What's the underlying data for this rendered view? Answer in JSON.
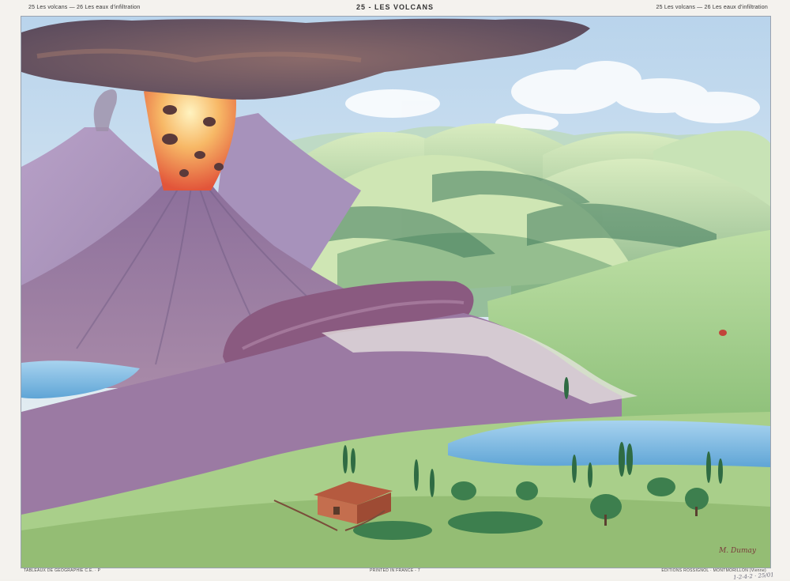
{
  "header": {
    "left": "25 Les volcans — 26 Les eaux d'infiltration",
    "title": "25 - LES VOLCANS",
    "right": "25 Les volcans — 26 Les eaux d'infiltration"
  },
  "artwork": {
    "signature": "M. Dumay"
  },
  "footer": {
    "left": "TABLEAUX DE GEOGRAPHIE C.E. · P",
    "middle": "PRINTED IN FRANCE - 7",
    "right": "EDITIONS ROSSIGNOL · MONTMORILLON (Vienne)"
  },
  "handwritten_note": "1-2-4-2 · 25/01"
}
